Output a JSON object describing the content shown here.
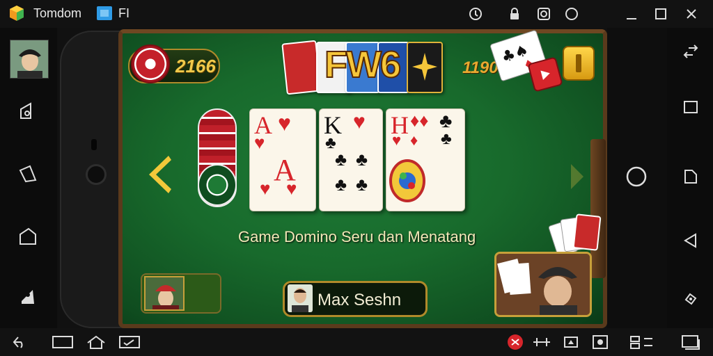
{
  "titlebar": {
    "app_title": "Tomdom",
    "tab_title": "FI",
    "buttons": [
      "pin",
      "lock",
      "camera",
      "record",
      "minimize",
      "maximize",
      "close"
    ]
  },
  "game": {
    "coins": "2166",
    "logo": "FW6",
    "score": "1190",
    "tagline": "Game Domino Seru dan Menatang",
    "player_name": "Max Seshn",
    "cards": [
      {
        "rank": "A",
        "suit": "hearts"
      },
      {
        "rank": "K",
        "suit": "clubs"
      },
      {
        "rank": "H",
        "suit": "mixed"
      }
    ]
  },
  "colors": {
    "felt": "#186a2c",
    "wood": "#5a3a1c",
    "gold": "#f0c94a",
    "red": "#d7252b"
  }
}
